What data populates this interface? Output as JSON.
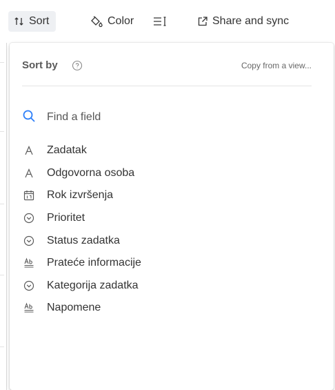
{
  "toolbar": {
    "sort_label": "Sort",
    "color_label": "Color",
    "share_label": "Share and sync"
  },
  "sort_popup": {
    "title": "Sort by",
    "copy_link": "Copy from a view...",
    "search_placeholder": "Find a field",
    "fields": [
      {
        "label": "Zadatak",
        "icon": "text-field-icon"
      },
      {
        "label": "Odgovorna osoba",
        "icon": "text-field-icon"
      },
      {
        "label": "Rok izvršenja",
        "icon": "calendar-icon"
      },
      {
        "label": "Prioritet",
        "icon": "single-select-icon"
      },
      {
        "label": "Status zadatka",
        "icon": "single-select-icon"
      },
      {
        "label": "Prateće informacije",
        "icon": "long-text-icon"
      },
      {
        "label": "Kategorija zadatka",
        "icon": "single-select-icon"
      },
      {
        "label": "Napomene",
        "icon": "long-text-icon"
      }
    ]
  },
  "colors": {
    "accent": "#2d7ff9",
    "sort_button_bg": "#eef0f3",
    "text": "#333333"
  }
}
